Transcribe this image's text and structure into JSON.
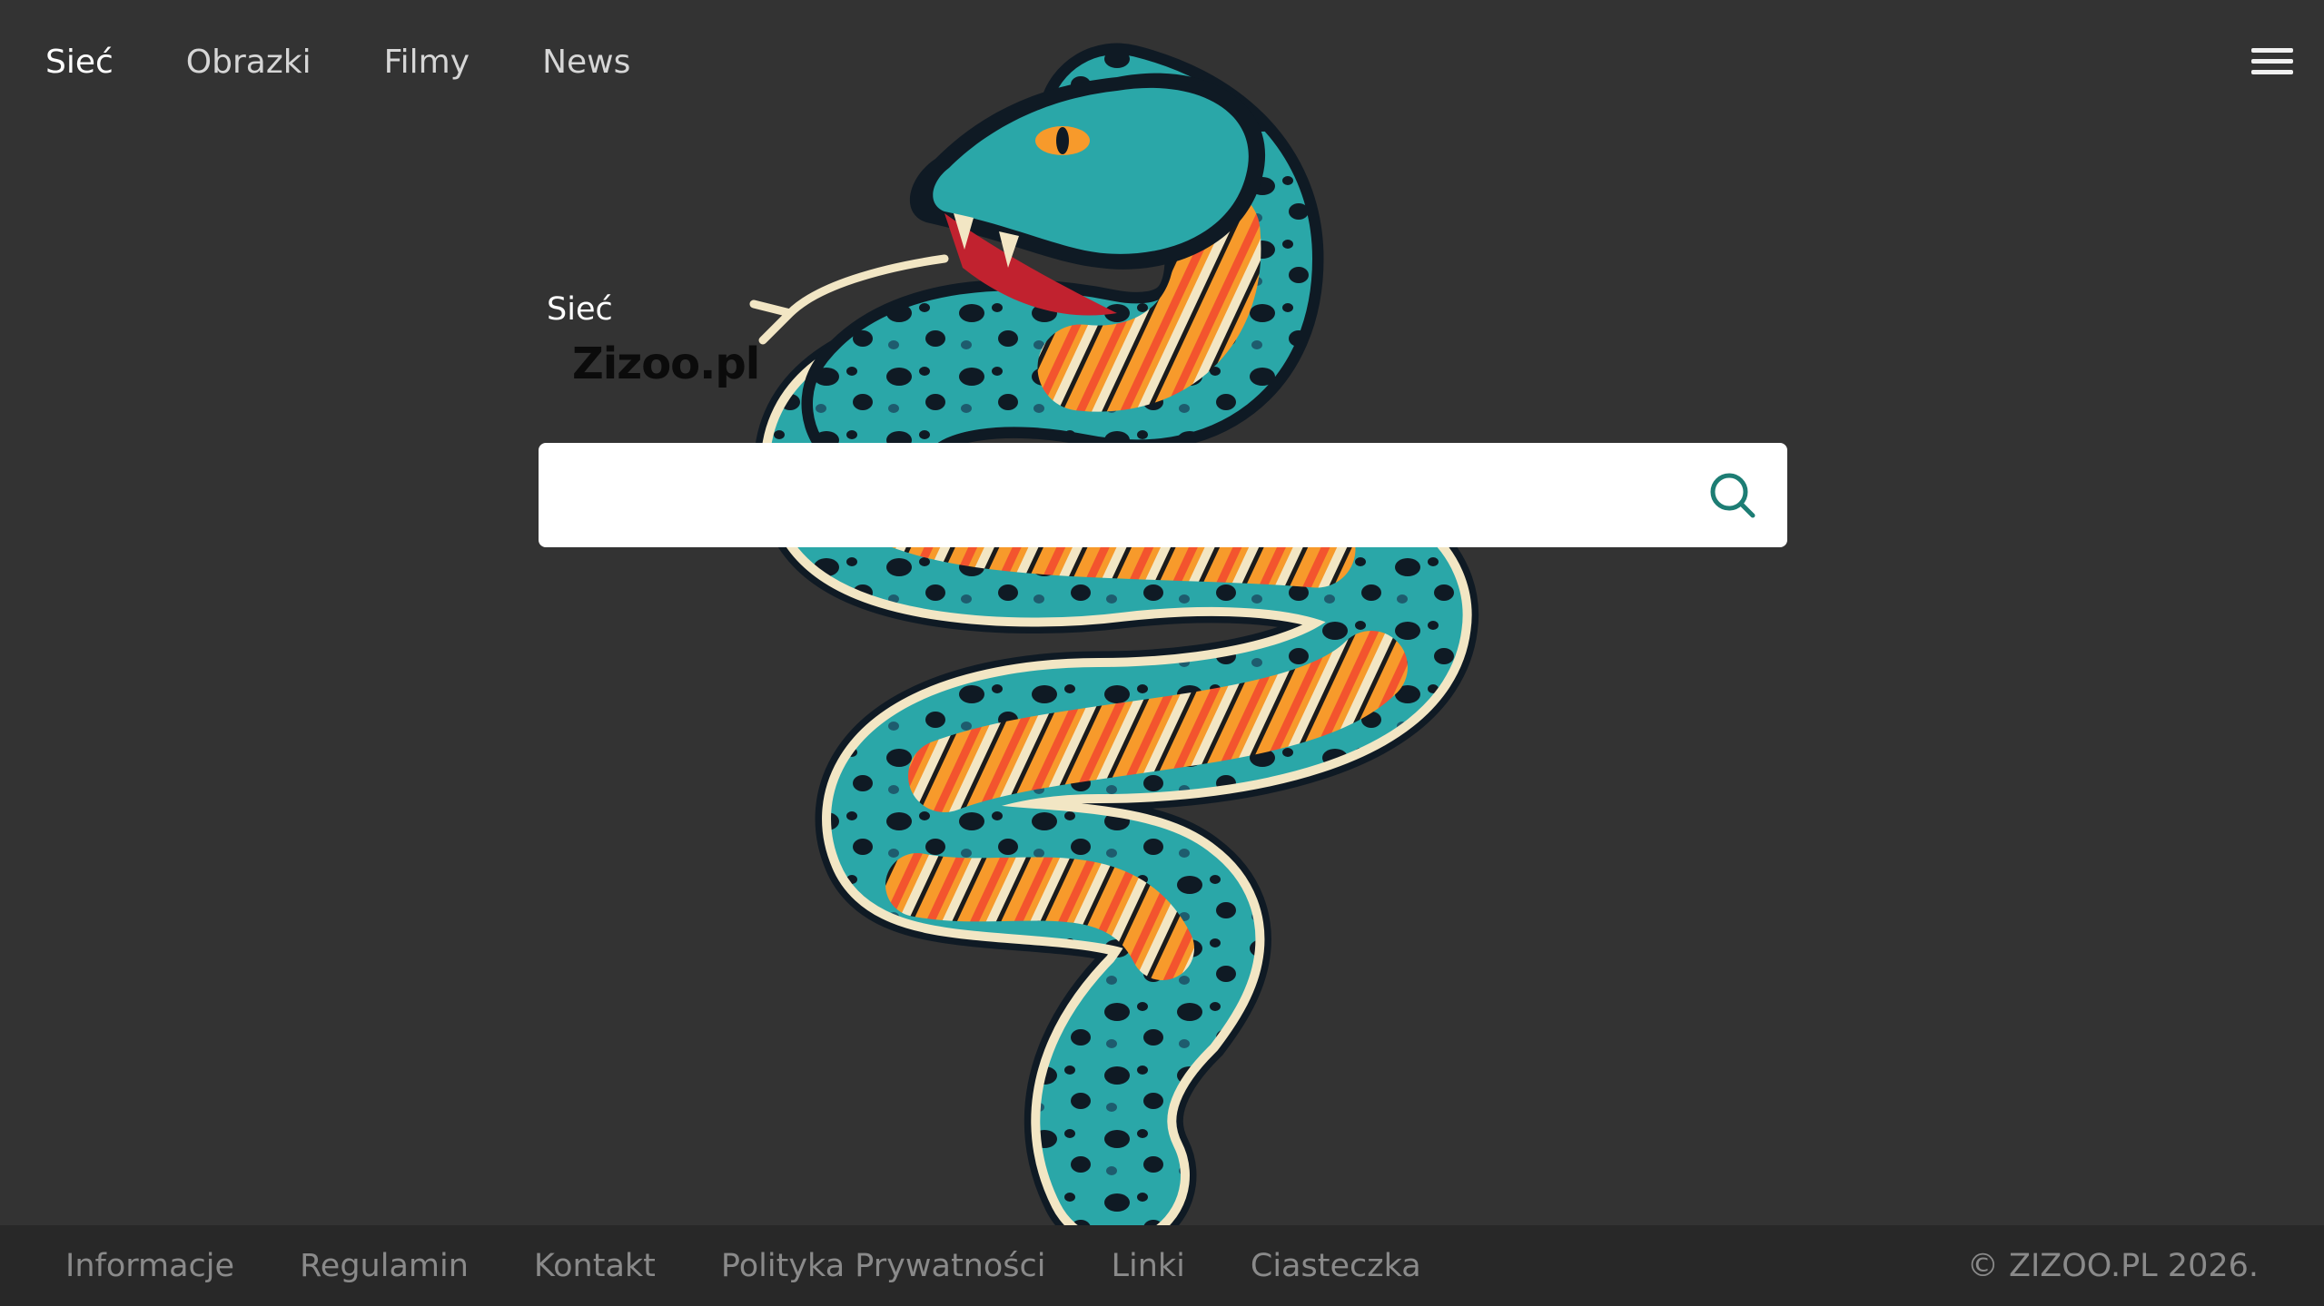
{
  "nav": {
    "items": [
      {
        "label": "Sieć",
        "active": true
      },
      {
        "label": "Obrazki",
        "active": false
      },
      {
        "label": "Filmy",
        "active": false
      },
      {
        "label": "News",
        "active": false
      }
    ],
    "menu_icon": "hamburger-menu-icon"
  },
  "logo": {
    "subtitle": "Sieć",
    "name": "Zizoo.pl"
  },
  "search": {
    "placeholder": "",
    "value": "",
    "button_icon": "search-icon",
    "icon_color": "#1d7d74"
  },
  "footer": {
    "links": [
      "Informacje",
      "Regulamin",
      "Kontakt",
      "Polityka Prywatności",
      "Linki",
      "Ciasteczka"
    ],
    "copyright": "© ZIZOO.PL 2026."
  },
  "colors": {
    "background": "#333333",
    "footer_background": "#282828",
    "snake_teal": "#2aa7a8",
    "snake_orange": "#f79a2b",
    "snake_cream": "#f2e6c4",
    "snake_dark": "#0f1a24"
  }
}
